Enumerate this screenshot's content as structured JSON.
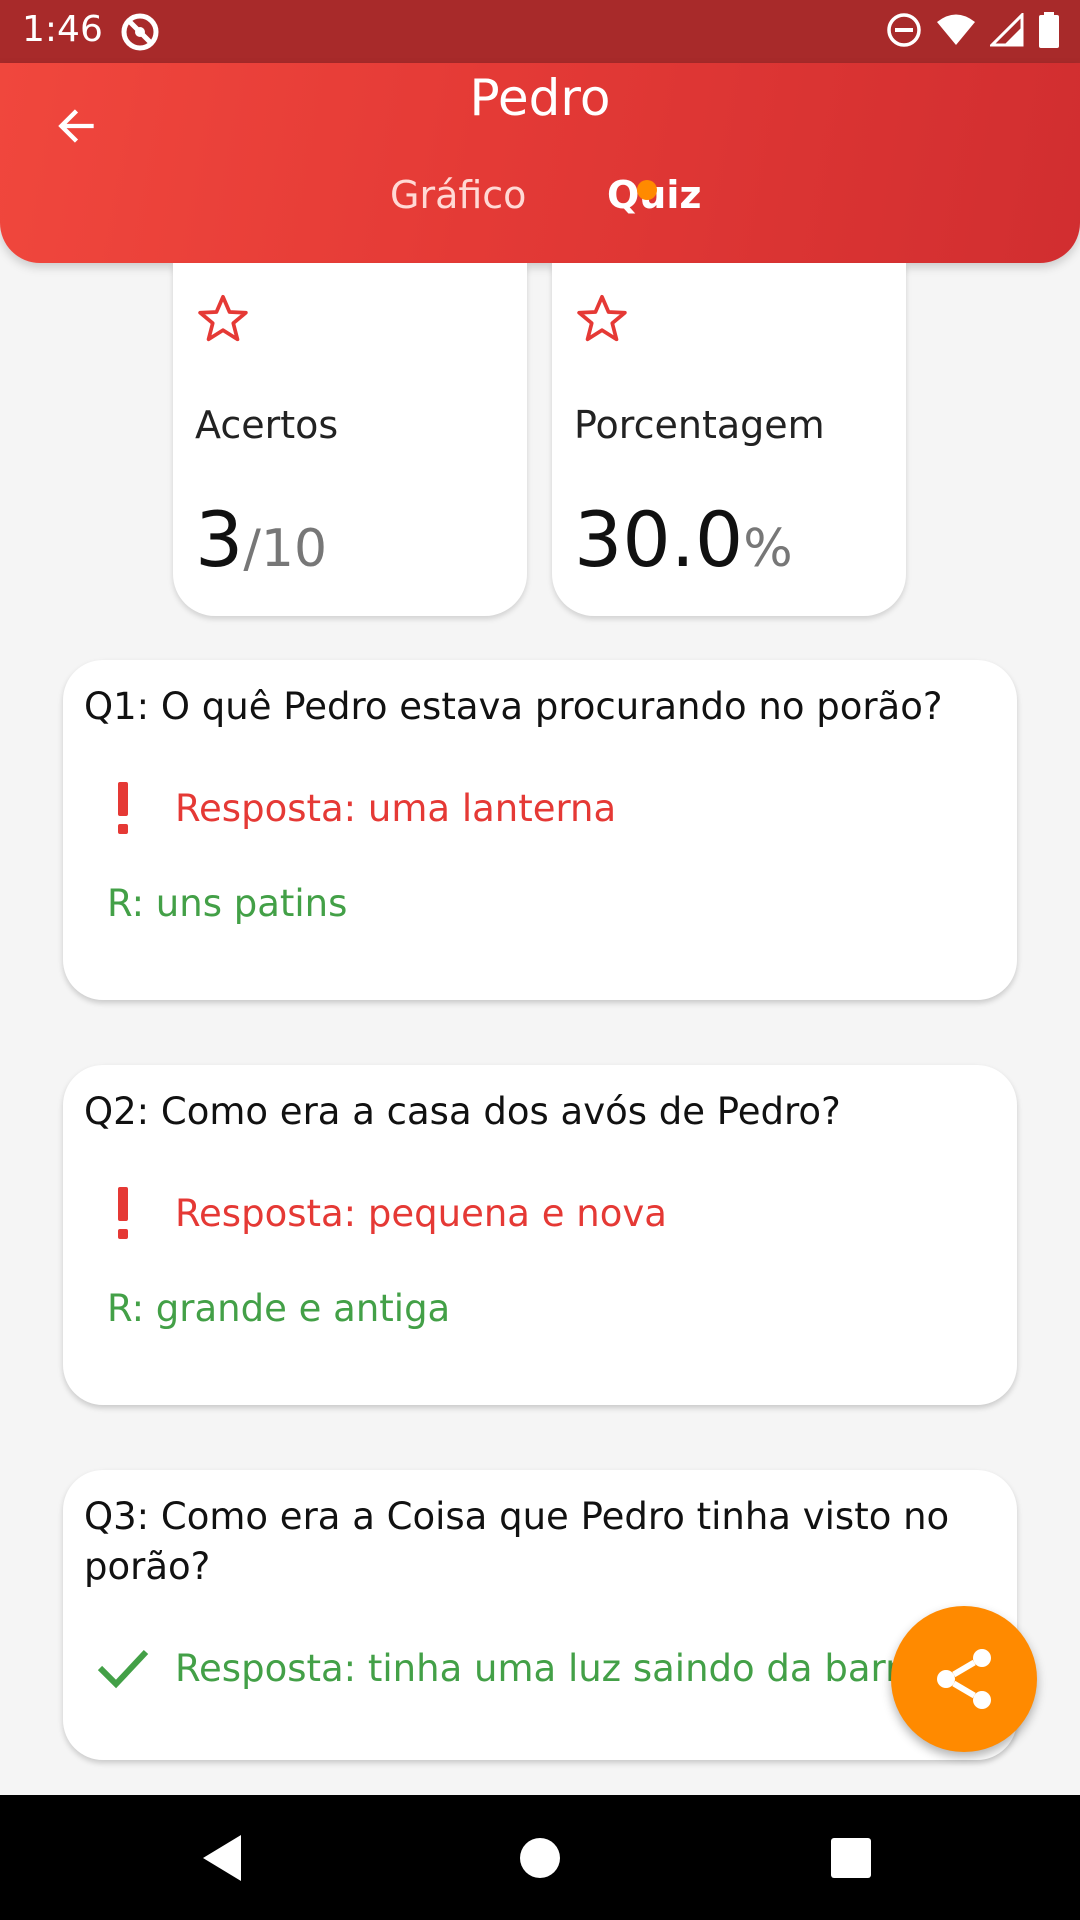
{
  "status_bar": {
    "time": "1:46"
  },
  "header": {
    "title": "Pedro",
    "tabs": [
      {
        "label": "Gráfico",
        "active": false
      },
      {
        "label": "Quiz",
        "active": true
      }
    ]
  },
  "stats": [
    {
      "label": "Acertos",
      "value": "3",
      "suffix": "/10"
    },
    {
      "label": "Porcentagem",
      "value": "30.0",
      "suffix": "%"
    }
  ],
  "questions": [
    {
      "question": "Q1:  O quê Pedro estava procurando no porão?",
      "answer": "Resposta: uma lanterna",
      "status": "wrong",
      "correct": "R: uns patins"
    },
    {
      "question": "Q2:  Como era a casa dos avós de Pedro?",
      "answer": "Resposta: pequena e nova",
      "status": "wrong",
      "correct": "R: grande e antiga"
    },
    {
      "question": "Q3:  Como era a Coisa que Pedro tinha visto no porão?",
      "answer": "Resposta: tinha uma luz saindo da barriga",
      "status": "correct"
    }
  ],
  "colors": {
    "primary": "#e53935",
    "accent": "#ff8a00",
    "correct": "#43a047",
    "wrong": "#e53935"
  },
  "icons": {
    "back": "arrow-left-icon",
    "star": "star-outline-icon",
    "wrong": "exclamation-icon",
    "correct": "check-icon",
    "share": "share-icon"
  }
}
